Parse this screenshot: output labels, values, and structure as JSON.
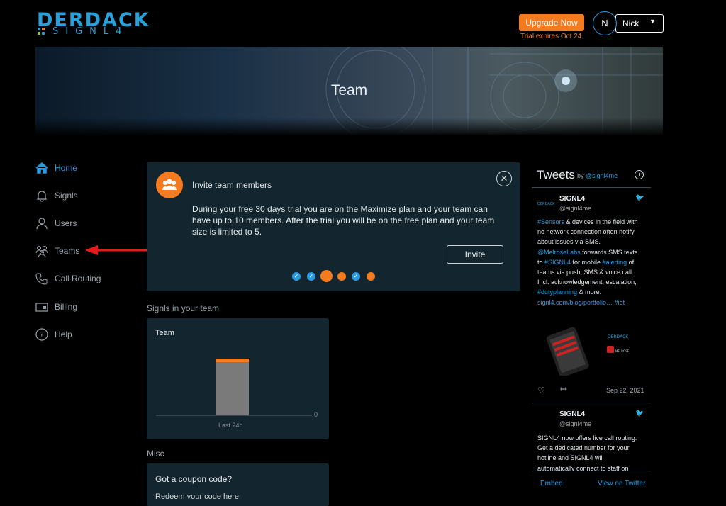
{
  "header": {
    "logo_main": "DERDACK",
    "logo_sub": "SIGNL4",
    "upgrade_label": "Upgrade Now",
    "trial_text": "Trial expires Oct 24",
    "avatar_initial": "N",
    "user_name": "Nick"
  },
  "banner": {
    "title": "Team"
  },
  "sidebar": {
    "items": [
      {
        "label": "Home",
        "icon": "home-icon",
        "active": true
      },
      {
        "label": "Signls",
        "icon": "bell-icon"
      },
      {
        "label": "Users",
        "icon": "user-icon"
      },
      {
        "label": "Teams",
        "icon": "teams-icon"
      },
      {
        "label": "Call Routing",
        "icon": "phone-icon"
      },
      {
        "label": "Billing",
        "icon": "billing-icon"
      },
      {
        "label": "Help",
        "icon": "help-icon"
      }
    ],
    "annotation_color": "#e31b1b"
  },
  "invite": {
    "title": "Invite team members",
    "body": "During your free 30 days trial you are on the Maximize plan and your team can have up to 10 members. After the trial you will be on the free plan and your team size is limited to 5.",
    "button": "Invite",
    "close_icon": "close-icon",
    "steps": [
      "done",
      "done",
      "current",
      "todo",
      "done",
      "todo"
    ]
  },
  "signls": {
    "heading": "Signls in your team",
    "card_title": "Team",
    "chart_data": {
      "type": "bar",
      "categories": [
        "Last 24h"
      ],
      "values": [
        0
      ],
      "y_tick": "0",
      "colors": {
        "bar": "#7a7a7a",
        "top": "#f47b20"
      }
    }
  },
  "misc": {
    "heading": "Misc",
    "coupon_title": "Got a coupon code?",
    "coupon_sub": "Redeem your code here"
  },
  "tweets": {
    "title": "Tweets",
    "by": "by",
    "by_handle": "@signl4me",
    "items": [
      {
        "name": "SIGNL4",
        "handle": "@signl4me",
        "lines": [
          [
            {
              "t": "#Sensors",
              "l": true
            },
            {
              "t": " & devices in the field with"
            }
          ],
          [
            {
              "t": "no network connection often notify"
            }
          ],
          [
            {
              "t": "about issues via SMS."
            }
          ],
          [
            {
              "t": "@MelroseLabs",
              "l": true
            },
            {
              "t": " forwards SMS texts"
            }
          ],
          [
            {
              "t": "to "
            },
            {
              "t": "#SIGNL4",
              "l": true
            },
            {
              "t": " for mobile "
            },
            {
              "t": "#alerting",
              "l": true
            },
            {
              "t": " of"
            }
          ],
          [
            {
              "t": "teams via push, SMS & voice call."
            }
          ],
          [
            {
              "t": "Incl. acknowledgement, escalation,"
            }
          ],
          [
            {
              "t": "#dutyplanning",
              "l": true
            },
            {
              "t": " & more."
            }
          ],
          [
            {
              "t": "signl4.com/blog/portfolio…",
              "l": true
            },
            {
              "t": " "
            },
            {
              "t": "#iot",
              "l": true
            }
          ]
        ],
        "date": "Sep 22, 2021",
        "image_logo": "DERDACK",
        "image_logo2": "MELROSE"
      },
      {
        "name": "SIGNL4",
        "handle": "@signl4me",
        "lines": [
          [
            {
              "t": "SIGNL4 now offers live call routing."
            }
          ],
          [
            {
              "t": "Get a dedicated number for your"
            }
          ],
          [
            {
              "t": "hotline and SIGNL4 will"
            }
          ],
          [
            {
              "t": "automatically connect to staff on"
            }
          ]
        ]
      }
    ],
    "embed": "Embed",
    "view": "View on Twitter"
  },
  "colors": {
    "accent": "#2a9be0",
    "orange": "#f47b20",
    "card": "#13252e"
  }
}
